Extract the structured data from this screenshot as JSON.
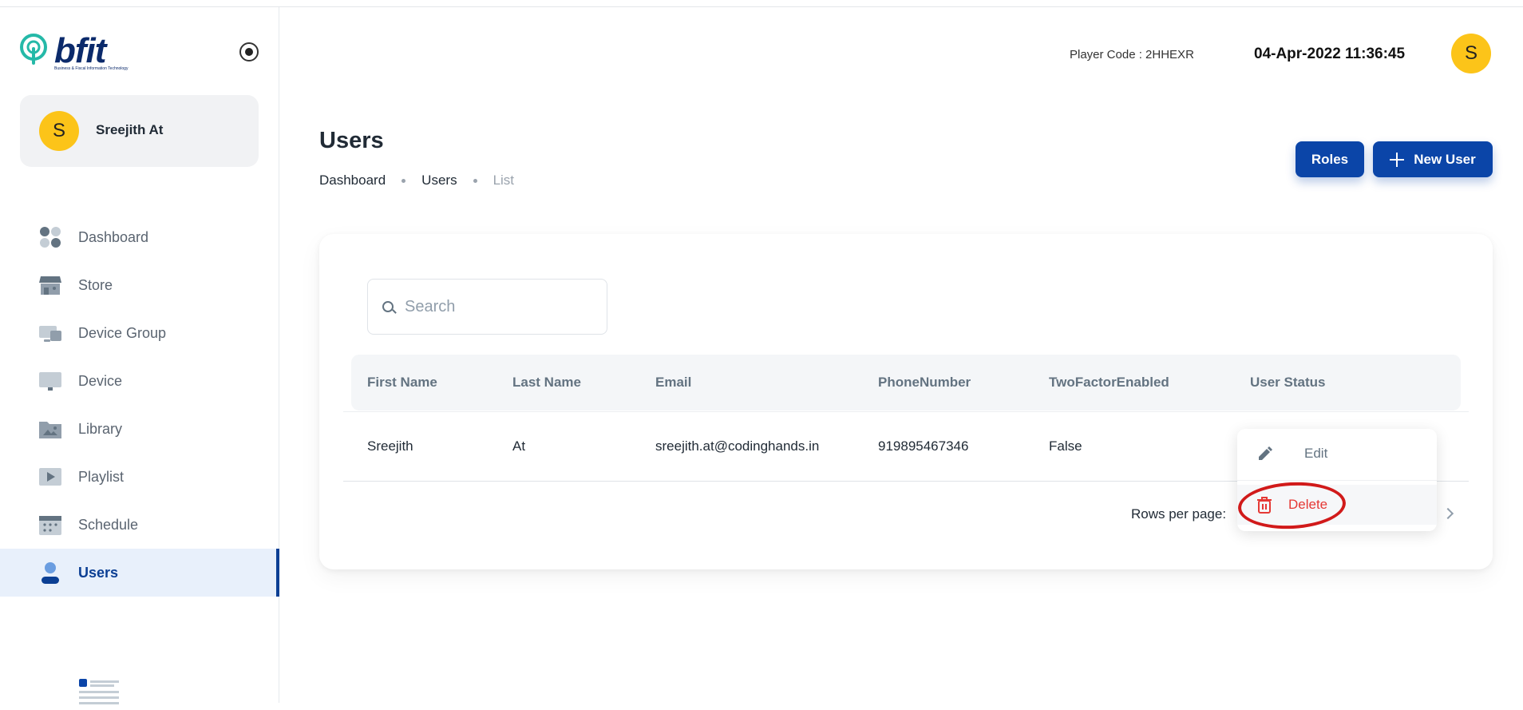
{
  "app": {
    "logo_text": "bfit",
    "logo_tagline": "Business & Fiscal Information Technology"
  },
  "sidebar": {
    "user": {
      "initial": "S",
      "name": "Sreejith At"
    },
    "items": [
      {
        "label": "Dashboard",
        "icon": "dashboard-icon",
        "active": false
      },
      {
        "label": "Store",
        "icon": "store-icon",
        "active": false
      },
      {
        "label": "Device Group",
        "icon": "device-group-icon",
        "active": false
      },
      {
        "label": "Device",
        "icon": "device-icon",
        "active": false
      },
      {
        "label": "Library",
        "icon": "library-icon",
        "active": false
      },
      {
        "label": "Playlist",
        "icon": "playlist-icon",
        "active": false
      },
      {
        "label": "Schedule",
        "icon": "schedule-icon",
        "active": false
      },
      {
        "label": "Users",
        "icon": "user-icon",
        "active": true
      }
    ]
  },
  "header": {
    "player_code": "Player Code : 2HHEXR",
    "datetime": "04-Apr-2022 11:36:45",
    "avatar_initial": "S"
  },
  "page": {
    "title": "Users",
    "breadcrumb": [
      "Dashboard",
      "Users",
      "List"
    ],
    "roles_label": "Roles",
    "new_user_label": "New User"
  },
  "search": {
    "placeholder": "Search",
    "value": ""
  },
  "table": {
    "headers": [
      "First Name",
      "Last Name",
      "Email",
      "PhoneNumber",
      "TwoFactorEnabled",
      "User Status"
    ],
    "rows": [
      {
        "first_name": "Sreejith",
        "last_name": "At",
        "email": "sreejith.at@codinghands.in",
        "phone": "919895467346",
        "two_factor": "False"
      }
    ],
    "rows_per_page_label": "Rows per page:"
  },
  "menu": {
    "edit_label": "Edit",
    "delete_label": "Delete"
  },
  "colors": {
    "primary": "#0b45a8",
    "active_nav": "#0b3f94",
    "avatar": "#fcc419",
    "danger": "#e53935",
    "annotation": "#d11a1a"
  }
}
